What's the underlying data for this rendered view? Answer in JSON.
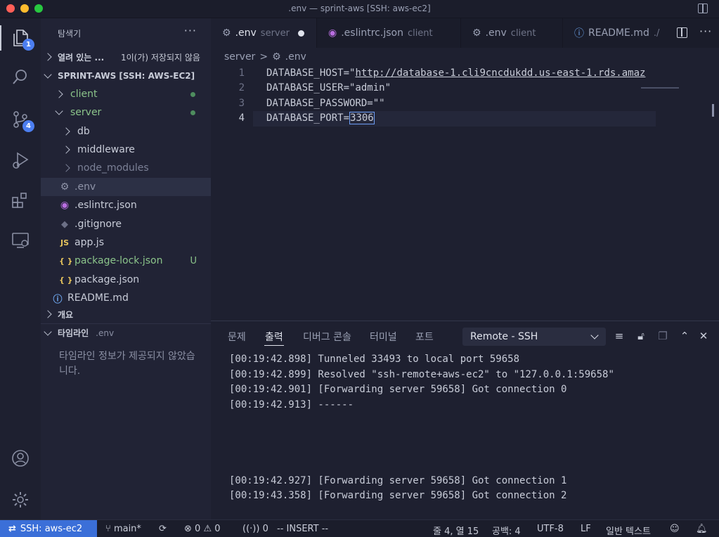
{
  "window": {
    "title": ".env — sprint-aws [SSH: aws-ec2]"
  },
  "activity": {
    "explorer_badge": "1",
    "scm_badge": "4"
  },
  "sidebar": {
    "title": "탐색기",
    "open_editors": {
      "label": "열려 있는 ...",
      "unsaved": "1이(가) 저장되지 않음"
    },
    "workspace": "SPRINT-AWS [SSH: AWS-EC2]",
    "tree": {
      "client": "client",
      "server": "server",
      "db": "db",
      "middleware": "middleware",
      "node_modules": "node_modules",
      "env": ".env",
      "eslintrc": ".eslintrc.json",
      "gitignore": ".gitignore",
      "appjs": "app.js",
      "packagelock": "package-lock.json",
      "packagelock_status": "U",
      "packagejson": "package.json",
      "readme": "README.md",
      "js_icon": "JS",
      "json_icon": "{ }"
    },
    "outline": "개요",
    "timeline": {
      "label": "타임라인",
      "file": ".env",
      "empty": "타임라인 정보가 제공되지 않았습니다."
    }
  },
  "tabs": [
    {
      "label": ".env",
      "desc": "server"
    },
    {
      "label": ".eslintrc.json",
      "desc": "client"
    },
    {
      "label": ".env",
      "desc": "client"
    },
    {
      "label": "README.md",
      "desc": "./"
    }
  ],
  "breadcrumb": {
    "folder": "server",
    "sep": ">",
    "file": ".env"
  },
  "editor": {
    "line_numbers": [
      "1",
      "2",
      "3",
      "4"
    ],
    "lines": {
      "l1_key": "DATABASE_HOST=\"",
      "l1_url": "http://database-1.cli9cncdukdd.us-east-1.rds.amaz",
      "l2": "DATABASE_USER=\"admin\"",
      "l3": "DATABASE_PASSWORD=\"\"",
      "l4_key": "DATABASE_PORT=",
      "l4_val": "3306"
    }
  },
  "panel": {
    "tabs": [
      "문제",
      "출력",
      "디버그 콘솔",
      "터미널",
      "포트"
    ],
    "channel": "Remote - SSH",
    "output": [
      "[00:19:42.898] Tunneled 33493 to local port 59658",
      "[00:19:42.899] Resolved \"ssh-remote+aws-ec2\" to \"127.0.0.1:59658\"",
      "[00:19:42.901] [Forwarding server 59658] Got connection 0",
      "[00:19:42.913] ------",
      "[00:19:42.927] [Forwarding server 59658] Got connection 1",
      "[00:19:43.358] [Forwarding server 59658] Got connection 2"
    ]
  },
  "status": {
    "remote": "SSH: aws-ec2",
    "branch": "main*",
    "errors": "0",
    "warnings": "0",
    "ports": "0",
    "mode": "-- INSERT --",
    "position": "줄 4, 열 15",
    "spaces": "공백: 4",
    "encoding": "UTF-8",
    "eol": "LF",
    "language": "일반 텍스트"
  },
  "colors": {
    "accent": "#3b6fd8",
    "badge": "#4c7ef0",
    "untracked_green": "#8bc48a",
    "json_yellow": "#e5c35c",
    "eslint_purple": "#b96ee0"
  }
}
